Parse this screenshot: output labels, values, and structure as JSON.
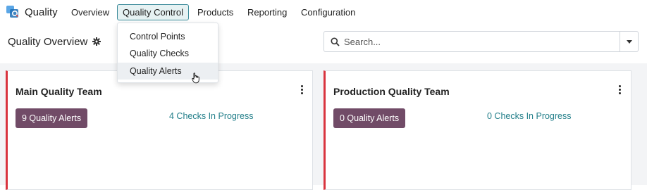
{
  "app": {
    "name": "Quality",
    "icon": "quality-app-icon"
  },
  "menu": {
    "items": [
      {
        "label": "Overview"
      },
      {
        "label": "Quality Control"
      },
      {
        "label": "Products"
      },
      {
        "label": "Reporting"
      },
      {
        "label": "Configuration"
      }
    ],
    "active": "Quality Control"
  },
  "dropdown": {
    "items": [
      {
        "label": "Control Points"
      },
      {
        "label": "Quality Checks"
      },
      {
        "label": "Quality Alerts"
      }
    ],
    "hovered": "Quality Alerts"
  },
  "page": {
    "title": "Quality Overview",
    "settings_icon": "gear-icon"
  },
  "search": {
    "placeholder": "Search..."
  },
  "teams": [
    {
      "name": "Main Quality Team",
      "alerts_label": "9 Quality Alerts",
      "checks_label": "4 Checks In Progress"
    },
    {
      "name": "Production Quality Team",
      "alerts_label": "0 Quality Alerts",
      "checks_label": "0 Checks In Progress"
    }
  ],
  "colors": {
    "accent": "#714b67",
    "link": "#237f8a",
    "card_border": "#d9343f",
    "active_menu_bg": "#e6f2f3"
  }
}
